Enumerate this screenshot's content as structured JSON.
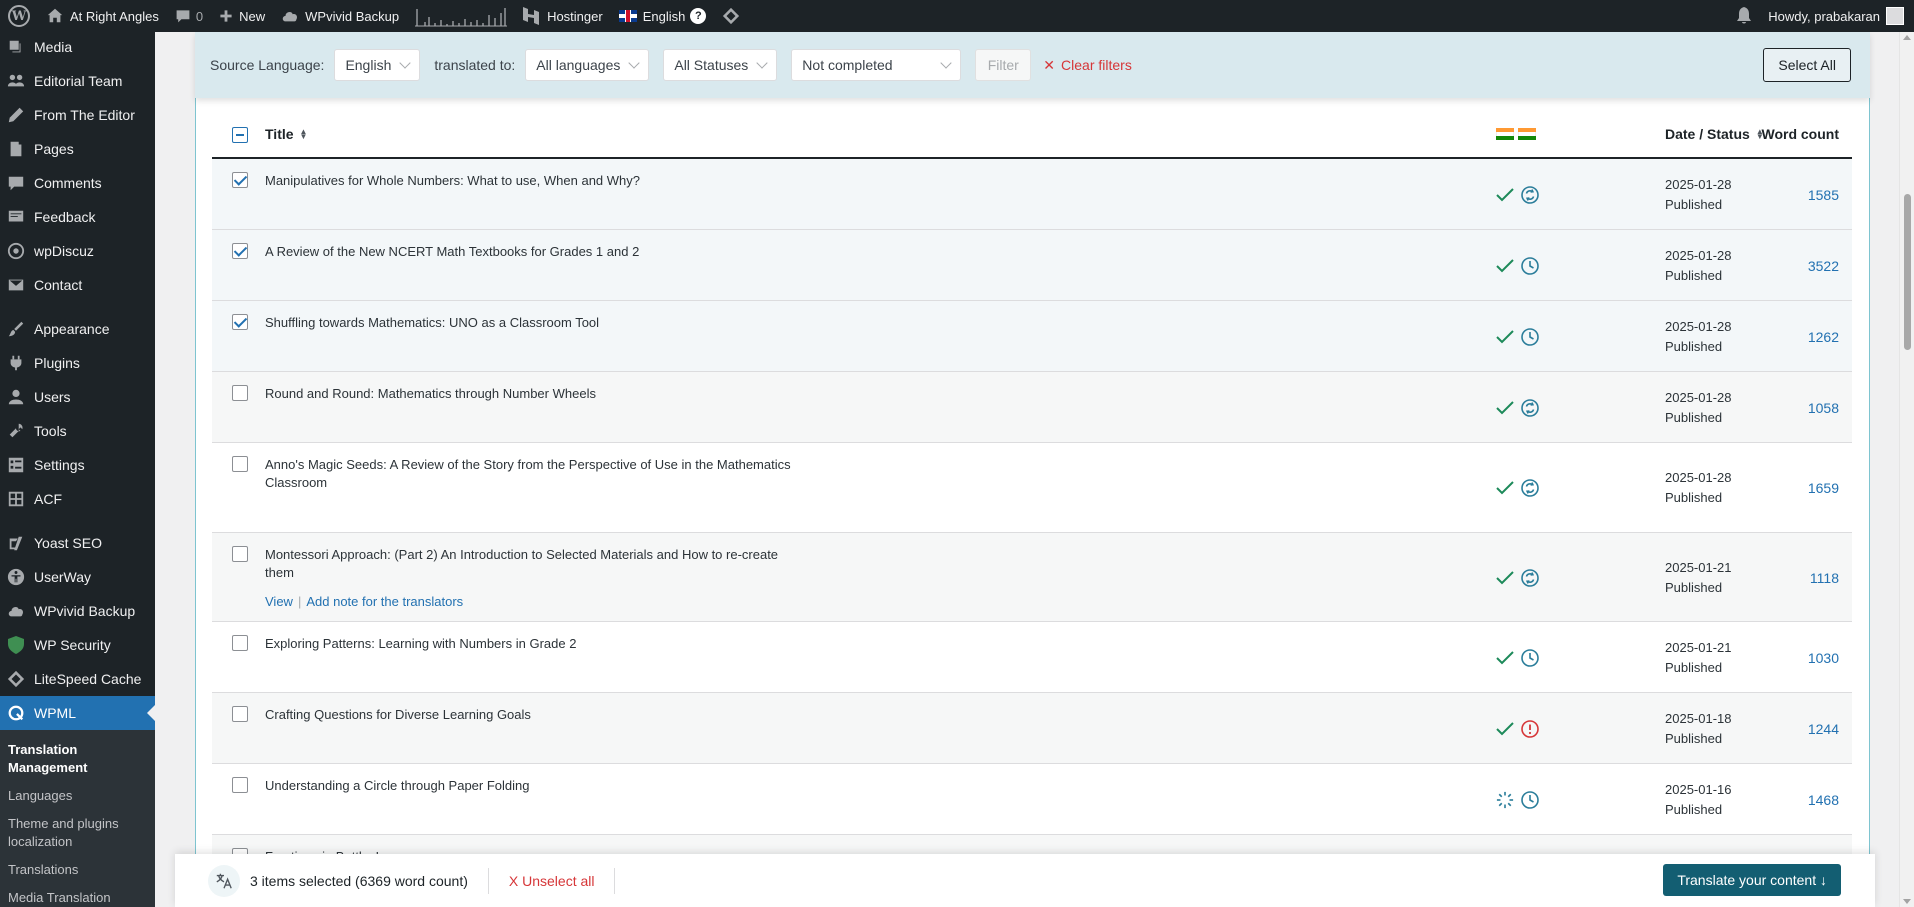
{
  "adminbar": {
    "site_name": "At Right Angles",
    "comments_count": "0",
    "new_label": "New",
    "backup_label": "WPvivid Backup",
    "hostinger_label": "Hostinger",
    "language_label": "English",
    "help_label": "?",
    "greeting": "Howdy, prabakaran"
  },
  "sidebar": {
    "items": [
      {
        "label": "Media",
        "icon": "media-icon"
      },
      {
        "label": "Editorial Team",
        "icon": "editorial-icon"
      },
      {
        "label": "From The Editor",
        "icon": "pen-icon"
      },
      {
        "label": "Pages",
        "icon": "pages-icon"
      },
      {
        "label": "Comments",
        "icon": "comment-icon"
      },
      {
        "label": "Feedback",
        "icon": "feedback-icon"
      },
      {
        "label": "wpDiscuz",
        "icon": "discuz-icon"
      },
      {
        "label": "Contact",
        "icon": "mail-icon"
      },
      {
        "label": "Appearance",
        "icon": "brush-icon"
      },
      {
        "label": "Plugins",
        "icon": "plug-icon"
      },
      {
        "label": "Users",
        "icon": "user-icon"
      },
      {
        "label": "Tools",
        "icon": "wrench-icon"
      },
      {
        "label": "Settings",
        "icon": "settings-icon"
      },
      {
        "label": "ACF",
        "icon": "grid-icon"
      },
      {
        "label": "Yoast SEO",
        "icon": "yoast-icon"
      },
      {
        "label": "UserWay",
        "icon": "accessibility-icon"
      },
      {
        "label": "WPvivid Backup",
        "icon": "cloud-icon"
      },
      {
        "label": "WP Security",
        "icon": "shield-icon"
      },
      {
        "label": "LiteSpeed Cache",
        "icon": "diamond-icon"
      },
      {
        "label": "WPML",
        "icon": "wpml-icon"
      }
    ],
    "submenu": [
      "Translation Management",
      "Languages",
      "Theme and plugins localization",
      "Translations",
      "Media Translation"
    ]
  },
  "filters": {
    "source_language_label": "Source Language:",
    "source_language_value": "English",
    "translated_to_label": "translated to:",
    "target_value": "All languages",
    "status_value": "All Statuses",
    "completion_value": "Not completed",
    "filter_button": "Filter",
    "clear_filters": "Clear filters",
    "select_all": "Select All"
  },
  "table": {
    "headers": {
      "title": "Title",
      "date_status": "Date / Status",
      "word_count": "Word count"
    },
    "rows": [
      {
        "title": "Manipulatives for Whole Numbers: What to use, When and Why?",
        "date": "2025-01-28",
        "status": "Published",
        "words": "1585",
        "checked": true,
        "icon": "sync"
      },
      {
        "title": "A Review of the New NCERT Math Textbooks for Grades 1 and 2",
        "date": "2025-01-28",
        "status": "Published",
        "words": "3522",
        "checked": true,
        "icon": "clock"
      },
      {
        "title": "Shuffling towards Mathematics: UNO as a Classroom Tool",
        "date": "2025-01-28",
        "status": "Published",
        "words": "1262",
        "checked": true,
        "icon": "clock"
      },
      {
        "title": "Round and Round: Mathematics through Number Wheels",
        "date": "2025-01-28",
        "status": "Published",
        "words": "1058",
        "checked": false,
        "icon": "sync"
      },
      {
        "title": "Anno's Magic Seeds: A Review of the Story from the Perspective of Use in the Mathematics Classroom",
        "date": "2025-01-28",
        "status": "Published",
        "words": "1659",
        "checked": false,
        "icon": "sync"
      },
      {
        "title": "Montessori Approach: (Part 2) An Introduction to Selected Materials and How to re-create them",
        "date": "2025-01-21",
        "status": "Published",
        "words": "1118",
        "checked": false,
        "icon": "sync",
        "actions": [
          "View",
          "Add note for the translators"
        ]
      },
      {
        "title": "Exploring Patterns: Learning with Numbers in Grade 2",
        "date": "2025-01-21",
        "status": "Published",
        "words": "1030",
        "checked": false,
        "icon": "clock"
      },
      {
        "title": "Crafting Questions for Diverse Learning Goals",
        "date": "2025-01-18",
        "status": "Published",
        "words": "1244",
        "checked": false,
        "icon": "alert"
      },
      {
        "title": "Understanding a Circle through Paper Folding",
        "date": "2025-01-16",
        "status": "Published",
        "words": "1468",
        "checked": false,
        "icon": "clock",
        "spinner": true
      },
      {
        "title": "Fractions in Bottles!",
        "date": "",
        "status": "",
        "words": "",
        "checked": false,
        "icon": ""
      }
    ]
  },
  "bottombar": {
    "selection_text": "3 items selected (6369 word count)",
    "unselect_label": "X Unselect all",
    "translate_label": "Translate your content ↓"
  },
  "colors": {
    "admin_bar": "#1d2327",
    "accent": "#2271b1",
    "check_green": "#1d8a5a",
    "status_teal": "#2a7d9a",
    "alert_red": "#d63638",
    "translate_btn": "#135e72"
  }
}
